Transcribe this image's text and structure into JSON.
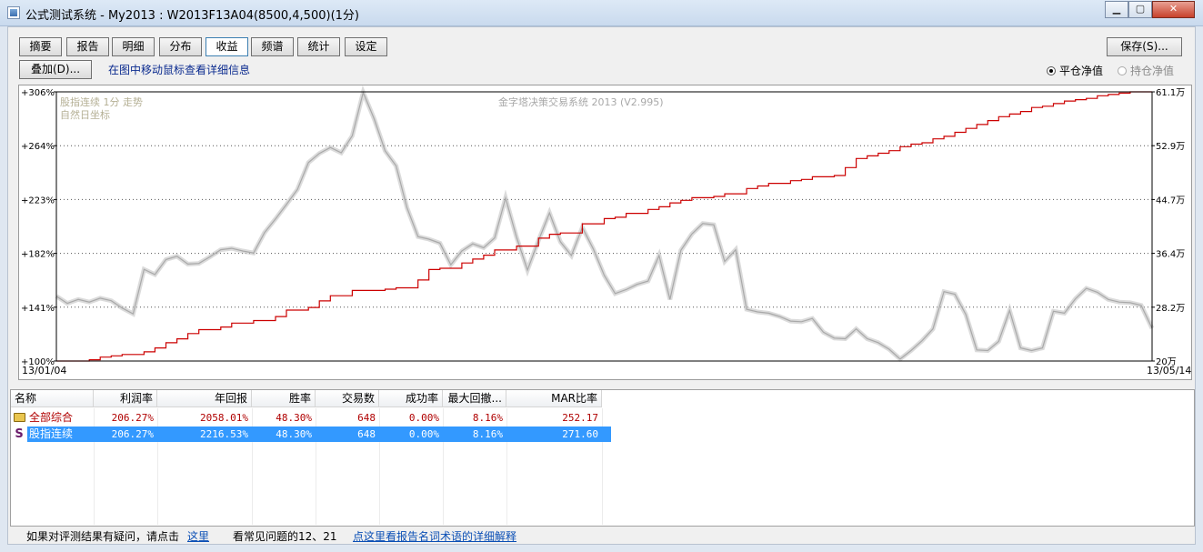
{
  "window": {
    "title": "公式测试系统 - My2013 : W2013F13A04(8500,4,500)(1分)",
    "controls": {
      "minimize": "▁",
      "maximize": "▢",
      "close": "✕"
    }
  },
  "tabs": [
    {
      "label": "摘要",
      "active": false
    },
    {
      "label": "报告",
      "active": false
    },
    {
      "label": "明细",
      "active": false
    },
    {
      "label": "分布",
      "active": false
    },
    {
      "label": "收益",
      "active": true
    },
    {
      "label": "频谱",
      "active": false
    },
    {
      "label": "统计",
      "active": false
    },
    {
      "label": "设定",
      "active": false
    }
  ],
  "toolbar": {
    "save_label": "保存(S)...",
    "overlay_label": "叠加(D)...",
    "hint": "在图中移动鼠标查看详细信息",
    "radio_flat": "平仓净值",
    "radio_hold": "持仓净值",
    "selected_radio": "平仓净值"
  },
  "chart_data": {
    "type": "line",
    "annotations": {
      "series_name": "股指连续 1分 走势",
      "coord_mode": "自然日坐标",
      "system": "金字塔决策交易系统 2013 (V2.995)"
    },
    "left_axis_ticks": [
      "+306%",
      "+264%",
      "+223%",
      "+182%",
      "+141%",
      "+100%"
    ],
    "left_ylim": [
      100,
      306
    ],
    "right_axis_ticks": [
      "61.1万",
      "52.9万",
      "44.7万",
      "36.4万",
      "28.2万",
      "20万"
    ],
    "right_ylim": [
      20,
      61.1
    ],
    "x_start": "13/01/04",
    "x_end": "13/05/14",
    "grid": true,
    "colors": {
      "equity": "#cc0000",
      "price": "#bdbdbd"
    },
    "series": [
      {
        "name": "股指连续 1分 走势",
        "axis": "right",
        "x": [
          0,
          1,
          2,
          3,
          4,
          5,
          6,
          7,
          8,
          9,
          10,
          11,
          12,
          13,
          14,
          15,
          16,
          17,
          18,
          19,
          20,
          21,
          22,
          23,
          24,
          25,
          26,
          27,
          28,
          29,
          30,
          31,
          32,
          33,
          34,
          35,
          36,
          37,
          38,
          39,
          40,
          41,
          42,
          43,
          44,
          45,
          46,
          47,
          48,
          49,
          50,
          51,
          52,
          53,
          54,
          55,
          56,
          57,
          58,
          59,
          60,
          61,
          62,
          63,
          64,
          65,
          66,
          67,
          68,
          69,
          70,
          71,
          72,
          73,
          74,
          75,
          76,
          77,
          78,
          79,
          80,
          81,
          82,
          83,
          84,
          85,
          86,
          87,
          88,
          89,
          90,
          91,
          92,
          93,
          94,
          95,
          96,
          97,
          98,
          99,
          100
        ],
        "values": [
          29.9,
          28.8,
          29.4,
          29.0,
          29.6,
          29.2,
          28.1,
          27.2,
          34.0,
          33.2,
          35.5,
          36.0,
          34.8,
          34.9,
          35.9,
          37.0,
          37.2,
          36.8,
          36.5,
          39.6,
          41.7,
          43.9,
          46.2,
          50.3,
          51.7,
          52.6,
          51.8,
          54.4,
          61.0,
          57.0,
          52.1,
          49.8,
          43.4,
          39.0,
          38.6,
          38.0,
          34.7,
          36.8,
          37.9,
          37.3,
          38.8,
          44.9,
          38.9,
          33.9,
          38.4,
          42.6,
          38.2,
          36.1,
          40.4,
          37.1,
          33.1,
          30.3,
          30.9,
          31.7,
          32.2,
          36.1,
          29.4,
          36.9,
          39.4,
          41.0,
          40.8,
          35.2,
          37.0,
          27.9,
          27.5,
          27.3,
          26.8,
          26.1,
          26.0,
          26.5,
          24.4,
          23.5,
          23.4,
          24.9,
          23.4,
          22.8,
          21.8,
          20.3,
          21.6,
          23.1,
          24.9,
          30.6,
          30.2,
          27.1,
          21.7,
          21.6,
          23.0,
          27.7,
          22.0,
          21.6,
          22.0,
          27.6,
          27.3,
          29.5,
          31.1,
          30.5,
          29.4,
          29.0,
          28.9,
          28.5,
          25.0
        ]
      },
      {
        "name": "平仓净值",
        "axis": "left",
        "x": [
          0,
          3,
          4,
          5,
          6,
          8,
          9,
          10,
          11,
          12,
          13,
          15,
          16,
          18,
          20,
          21,
          23,
          24,
          25,
          27,
          30,
          31,
          33,
          34,
          35,
          37,
          38,
          39,
          40,
          42,
          44,
          45,
          46,
          48,
          50,
          51,
          52,
          54,
          55,
          56,
          57,
          58,
          60,
          61,
          63,
          64,
          65,
          67,
          68,
          69,
          70,
          71,
          72,
          73,
          74,
          75,
          76,
          77,
          78,
          79,
          80,
          81,
          82,
          83,
          84,
          85,
          86,
          87,
          88,
          89,
          90,
          91,
          92,
          93,
          94,
          95,
          96,
          97,
          98,
          99,
          100
        ],
        "values": [
          100,
          101,
          103,
          104,
          105,
          107,
          110,
          114,
          117,
          121,
          124,
          126,
          129,
          131,
          134,
          139,
          141,
          146,
          150,
          154,
          155,
          156,
          162,
          170,
          171,
          175,
          178,
          181,
          185,
          188,
          194,
          197,
          198,
          205,
          209,
          210,
          213,
          216,
          218,
          221,
          223,
          225,
          226,
          228,
          232,
          234,
          236,
          238,
          239,
          241,
          241,
          242,
          248,
          255,
          257,
          259,
          261,
          264,
          266,
          267,
          270,
          272,
          275,
          278,
          281,
          284,
          287,
          289,
          291,
          294,
          295,
          297,
          299,
          300,
          301,
          303,
          304,
          305,
          306,
          306,
          306
        ]
      }
    ]
  },
  "table": {
    "columns": [
      "名称",
      "利润率",
      "年回报",
      "胜率",
      "交易数",
      "成功率",
      "最大回撤...",
      "MAR比率"
    ],
    "rows": [
      {
        "icon": "folder-icon",
        "name": "全部综合",
        "profit": "206.27%",
        "annual": "2058.01%",
        "win": "48.30%",
        "trades": "648",
        "success": "0.00%",
        "drawdown": "8.16%",
        "mar": "252.17",
        "selected": false
      },
      {
        "icon": "S",
        "name": "股指连续",
        "profit": "206.27%",
        "annual": "2216.53%",
        "win": "48.30%",
        "trades": "648",
        "success": "0.00%",
        "drawdown": "8.16%",
        "mar": "271.60",
        "selected": true
      }
    ]
  },
  "footer": {
    "question_text": "如果对评测结果有疑问，请点击",
    "here_link": "这里",
    "faq_text": "看常见问题的12、21",
    "glossary_link": "点这里看报告名词术语的详细解释"
  }
}
